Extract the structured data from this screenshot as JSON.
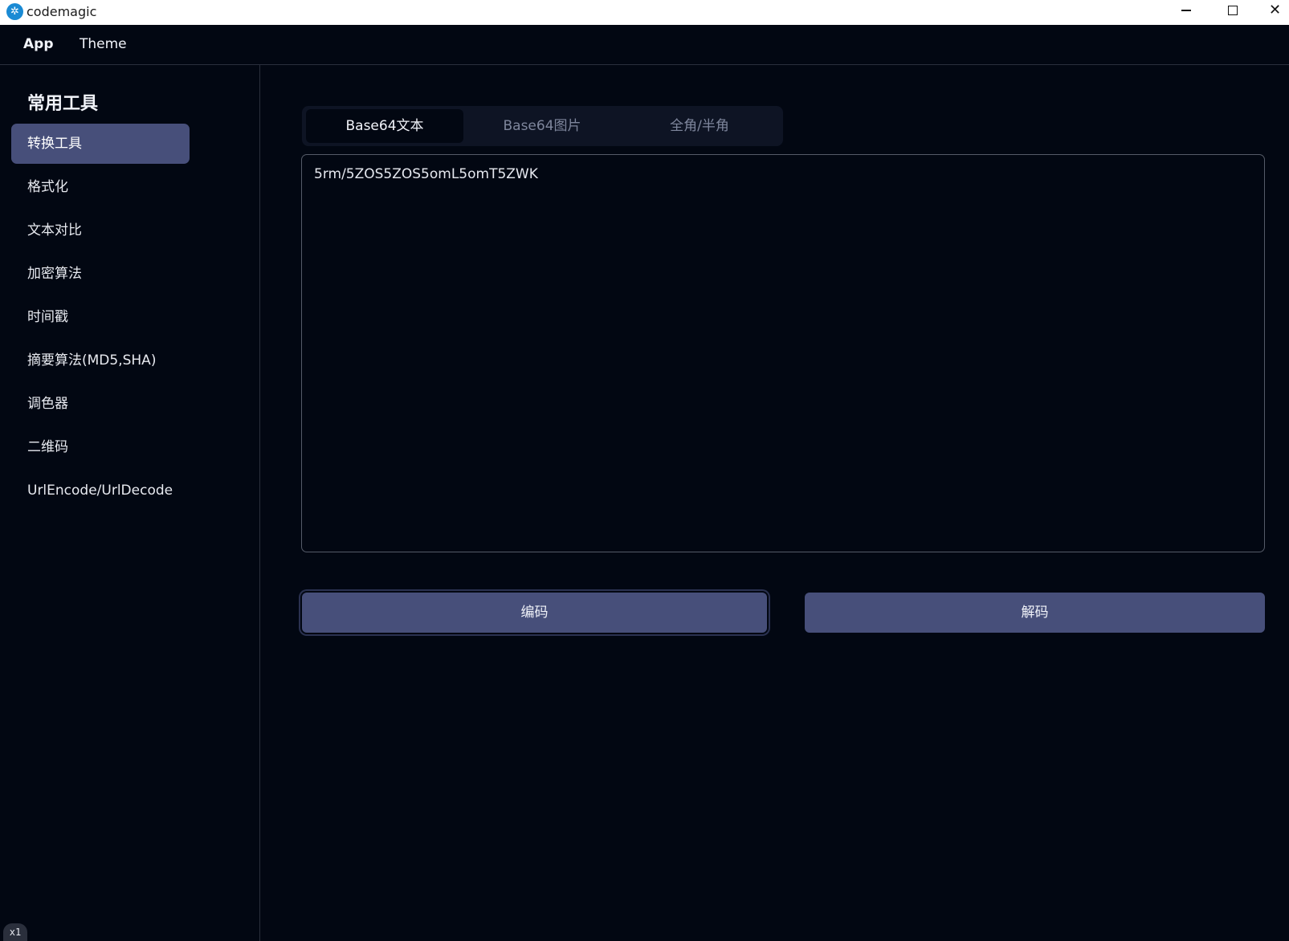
{
  "window": {
    "title": "codemagic",
    "icon": "codemagic-logo-icon"
  },
  "menubar": {
    "items": [
      "App",
      "Theme"
    ]
  },
  "sidebar": {
    "title": "常用工具",
    "items": [
      {
        "label": "转换工具",
        "active": true
      },
      {
        "label": "格式化",
        "active": false
      },
      {
        "label": "文本对比",
        "active": false
      },
      {
        "label": "加密算法",
        "active": false
      },
      {
        "label": "时间戳",
        "active": false
      },
      {
        "label": "摘要算法(MD5,SHA)",
        "active": false
      },
      {
        "label": "调色器",
        "active": false
      },
      {
        "label": "二维码",
        "active": false
      },
      {
        "label": "UrlEncode/UrlDecode",
        "active": false
      }
    ]
  },
  "main": {
    "tabs": [
      {
        "label": "Base64文本",
        "active": true
      },
      {
        "label": "Base64图片",
        "active": false
      },
      {
        "label": "全角/半角",
        "active": false
      }
    ],
    "input": {
      "value": "5rm/5ZOS5ZOS5omL5omT5ZWK"
    },
    "buttons": {
      "encode": "编码",
      "decode": "解码"
    }
  },
  "status": {
    "zoom": "x1"
  },
  "colors": {
    "background": "#020712",
    "accent": "#474f7a",
    "border": "#2a2f3c"
  }
}
